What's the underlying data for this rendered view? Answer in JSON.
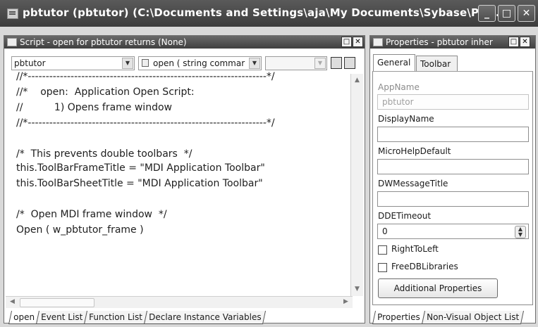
{
  "window": {
    "title": "pbtutor (pbtutor) (C:\\Documents and Settings\\aja\\My Documents\\Sybase\\Pow...",
    "min_icon": "minimize-icon",
    "max_icon": "maximize-icon",
    "close_icon": "close-icon"
  },
  "script_pane": {
    "title": "Script - open for pbtutor returns (None)",
    "object_combo": "pbtutor",
    "event_combo": "open ( string commar",
    "third_combo": "",
    "code_lines": [
      "//*-------------------------------------------------------------------*/",
      "//*    open:  Application Open Script:",
      "//          1) Opens frame window",
      "//*-------------------------------------------------------------------*/",
      "",
      "/*  This prevents double toolbars  */",
      "this.ToolBarFrameTitle = \"MDI Application Toolbar\"",
      "this.ToolBarSheetTitle = \"MDI Application Toolbar\"",
      "",
      "/*  Open MDI frame window  */",
      "Open ( w_pbtutor_frame )"
    ],
    "bottom_tabs": [
      "open",
      "Event List",
      "Function List",
      "Declare Instance Variables"
    ]
  },
  "properties_pane": {
    "title": "Properties - pbtutor  inher",
    "tabs": [
      "General",
      "Toolbar"
    ],
    "fields": {
      "appname_label": "AppName",
      "appname_value": "pbtutor",
      "displayname_label": "DisplayName",
      "displayname_value": "",
      "microhelp_label": "MicroHelpDefault",
      "microhelp_value": "",
      "dwmessage_label": "DWMessageTitle",
      "dwmessage_value": "",
      "ddetimeout_label": "DDETimeout",
      "ddetimeout_value": "0",
      "righttoleft_label": "RightToLeft",
      "freedblibraries_label": "FreeDBLibraries"
    },
    "additional_button": "Additional Properties",
    "bottom_tabs": [
      "Properties",
      "Non-Visual Object List"
    ]
  }
}
